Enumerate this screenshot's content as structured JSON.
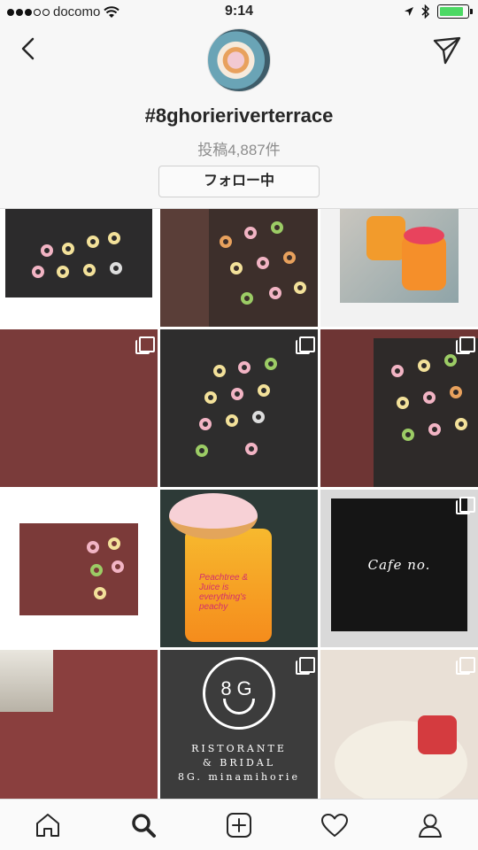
{
  "status_bar": {
    "carrier": "docomo",
    "time": "9:14",
    "battery_level": 0.85,
    "battery_color": "#4cd964"
  },
  "header": {
    "back_icon": "chevron-left-icon",
    "share_icon": "paper-plane-icon",
    "hashtag": "#8ghorieriverterrace",
    "post_count": "投稿4,887件",
    "follow_button": "フォロー中"
  },
  "grid": {
    "tiles": [
      {
        "subject": "donut-wall-welcome",
        "multi": false
      },
      {
        "subject": "donut-wall",
        "multi": false
      },
      {
        "subject": "juice-jars",
        "multi": false
      },
      {
        "subject": "cafe-interior",
        "multi": true
      },
      {
        "subject": "donut-wall-welcome",
        "multi": true
      },
      {
        "subject": "donut-wall-shelves",
        "multi": true
      },
      {
        "subject": "donut-wall-room",
        "multi": false
      },
      {
        "subject": "peach-juice-donut",
        "multi": false
      },
      {
        "subject": "cafe-sign",
        "multi": true
      },
      {
        "subject": "wedding-hall",
        "multi": false
      },
      {
        "subject": "restaurant-logo",
        "multi": true
      },
      {
        "subject": "food-plates",
        "multi": true
      }
    ],
    "juice_label": "Peachtree & Juice is everything's peachy",
    "cafe_sign": "Cafe no.",
    "logo_text": "8G",
    "brand_lines": [
      "RISTORANTE",
      "& BRIDAL",
      "8G. minamihorie"
    ]
  },
  "tab_bar": {
    "items": [
      "home-icon",
      "search-icon",
      "add-post-icon",
      "heart-icon",
      "profile-icon"
    ],
    "active": "search-icon"
  }
}
